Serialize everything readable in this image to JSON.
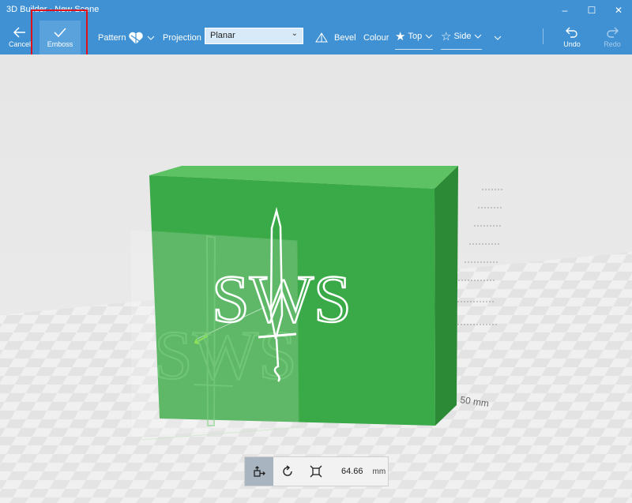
{
  "window": {
    "title": "3D Builder - New Scene",
    "minimize": "–",
    "maximize": "☐",
    "close": "✕"
  },
  "toolbar": {
    "cancel_label": "Cancel",
    "emboss_label": "Emboss",
    "pattern_label": "Pattern",
    "projection_label": "Projection",
    "projection_value": "Planar",
    "bevel_label": "Bevel",
    "colour_label": "Colour",
    "top_label": "Top",
    "side_label": "Side",
    "undo_label": "Undo",
    "redo_label": "Redo"
  },
  "scene": {
    "ruler_label": "50 mm",
    "emboss_text": "SWS",
    "box_color": "#3aa947"
  },
  "bottombar": {
    "size_value": "64.66",
    "unit": "mm"
  },
  "colors": {
    "accent": "#3f91d4",
    "highlight": "#e0101a"
  }
}
